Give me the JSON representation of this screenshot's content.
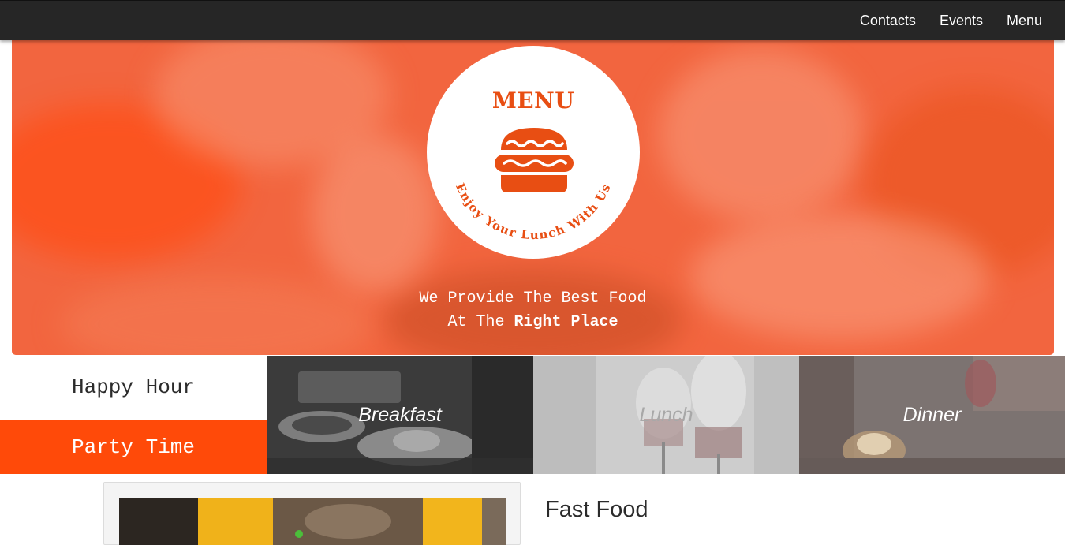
{
  "nav": {
    "links": [
      "Contacts",
      "Events",
      "Menu"
    ]
  },
  "hero": {
    "logo_title": "MENU",
    "logo_arc_text": "Enjoy Your Lunch With Us",
    "tagline_line1": "We Provide The Best Food",
    "tagline_line2_prefix": "At The ",
    "tagline_line2_bold": "Right Place"
  },
  "tabs": {
    "happy_hour": "Happy Hour",
    "party_time": "Party Time"
  },
  "categories": {
    "breakfast": "Breakfast",
    "lunch": "Lunch",
    "dinner": "Dinner"
  },
  "content": {
    "title": "Fast Food"
  },
  "colors": {
    "accent": "#ff4a09",
    "logo_orange": "#e84e13",
    "navbar": "#262626"
  },
  "icons": [
    "burger-icon"
  ]
}
